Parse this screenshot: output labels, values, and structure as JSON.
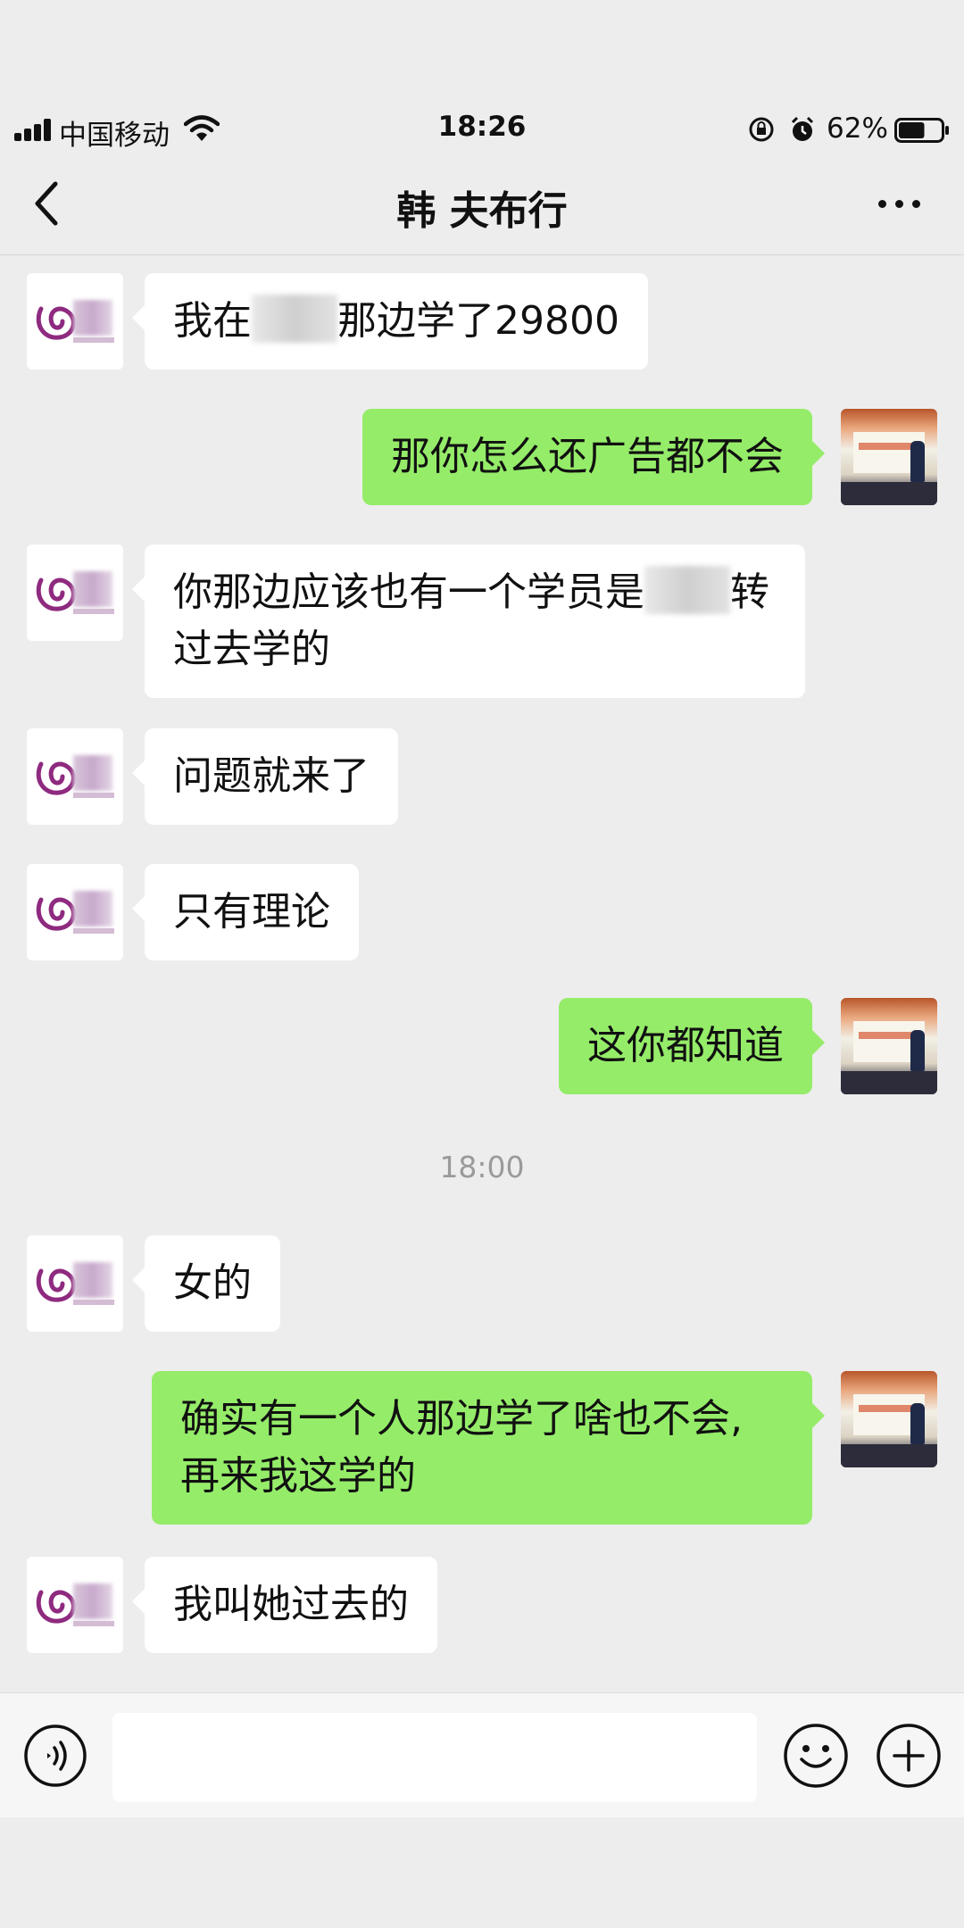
{
  "status": {
    "carrier": "中国移动",
    "time": "18:26",
    "battery": "62%",
    "battery_level": 0.62
  },
  "header": {
    "title": "韩  夫布行"
  },
  "messages": [
    {
      "from": "contact",
      "before": "我在",
      "after": "那边学了29800",
      "redacted": true
    },
    {
      "from": "me",
      "text": "那你怎么还广告都不会"
    },
    {
      "from": "contact",
      "line1_before": "你那边应该也有一个学员是",
      "line1_after": "转",
      "line2": "过去学的",
      "redacted": true
    },
    {
      "from": "contact",
      "text": "问题就来了"
    },
    {
      "from": "contact",
      "text": "只有理论"
    },
    {
      "from": "me",
      "text": "这你都知道"
    },
    {
      "from": "contact",
      "text": "女的"
    },
    {
      "from": "me",
      "line1": "确实有一个人那边学了啥也不会,",
      "line2": "再来我这学的"
    },
    {
      "from": "contact",
      "text": "我叫她过去的"
    }
  ],
  "time_separator": "18:00",
  "input": {
    "value": ""
  },
  "icons": {
    "back": "back-icon",
    "more": "more-icon",
    "voice": "voice-icon",
    "emoji": "emoji-icon",
    "plus": "plus-icon",
    "contact_avatar": "brand-logo-avatar",
    "self_avatar": "photo-avatar"
  },
  "colors": {
    "background": "#ededed",
    "outgoing_bubble": "#95ec69",
    "incoming_bubble": "#ffffff",
    "logo_purple": "#8e2a7f"
  }
}
